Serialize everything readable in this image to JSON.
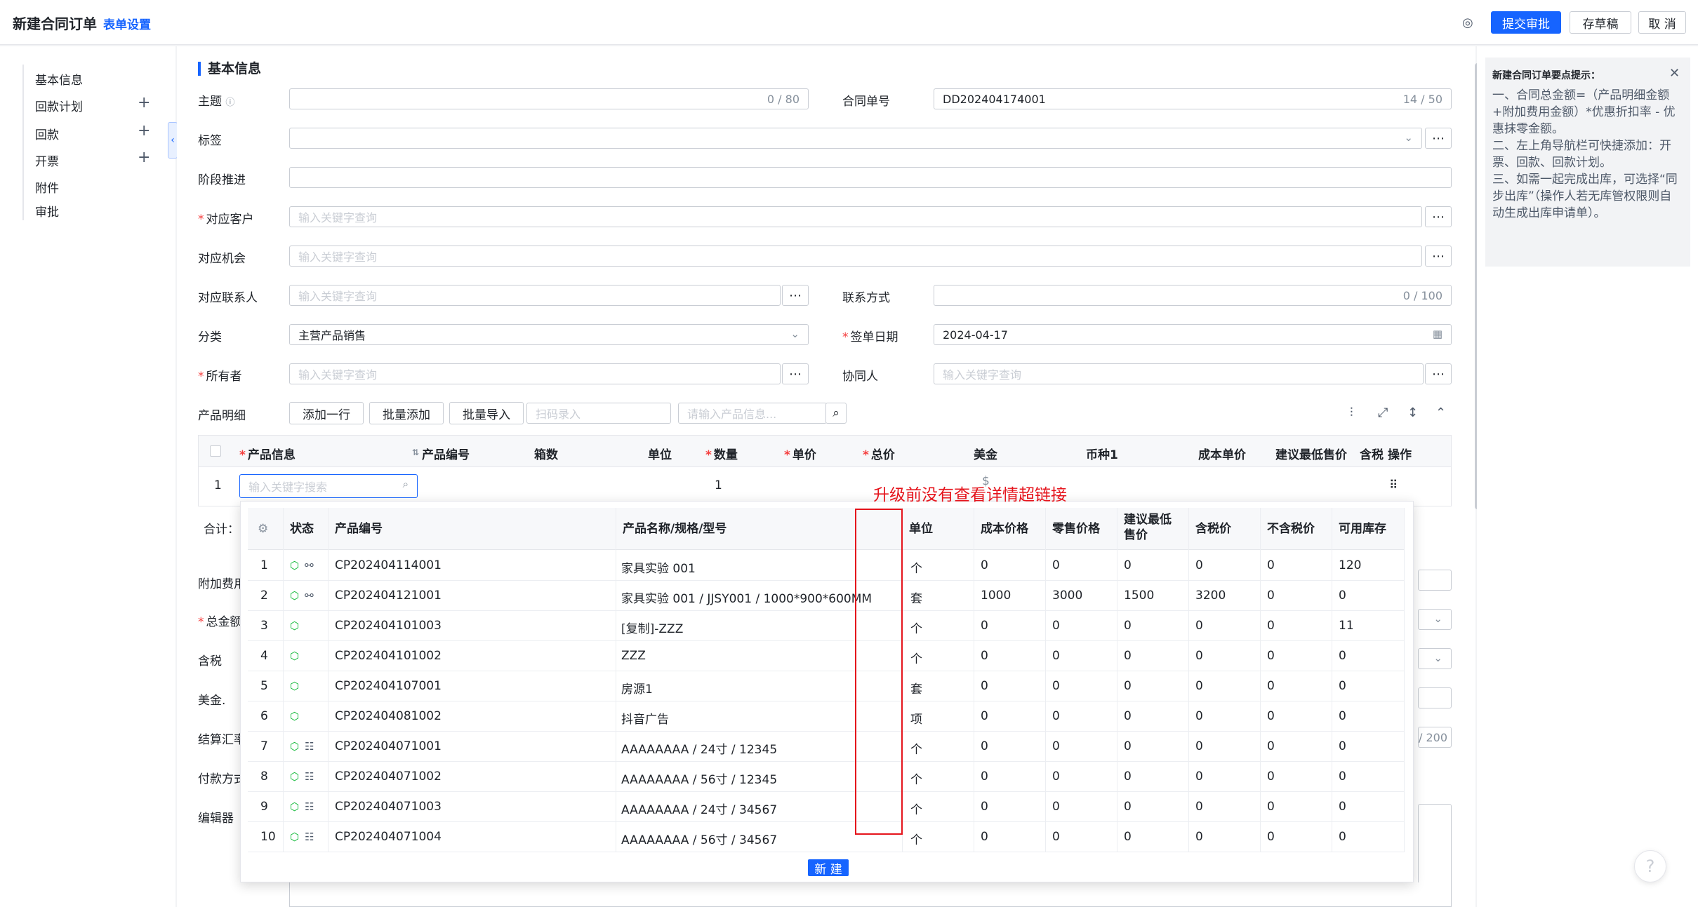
{
  "header": {
    "title": "新建合同订单",
    "form_setting": "表单设置",
    "submit": "提交审批",
    "draft": "存草稿",
    "cancel": "取 消"
  },
  "nav": {
    "items": [
      {
        "label": "基本信息",
        "plus": false
      },
      {
        "label": "回款计划",
        "plus": true
      },
      {
        "label": "回款",
        "plus": true
      },
      {
        "label": "开票",
        "plus": true
      },
      {
        "label": "附件",
        "plus": false
      },
      {
        "label": "审批",
        "plus": false
      }
    ]
  },
  "form": {
    "section_title": "基本信息",
    "subject": {
      "label": "主题",
      "counter": "0 / 80"
    },
    "contract_no": {
      "label": "合同单号",
      "value": "DD202404174001",
      "counter": "14 / 50"
    },
    "tag": {
      "label": "标签"
    },
    "stage": {
      "label": "阶段推进"
    },
    "customer": {
      "label": "对应客户",
      "placeholder": "输入关键字查询"
    },
    "opportunity": {
      "label": "对应机会",
      "placeholder": "输入关键字查询"
    },
    "contact": {
      "label": "对应联系人",
      "placeholder": "输入关键字查询"
    },
    "contact_method": {
      "label": "联系方式",
      "counter": "0 / 100"
    },
    "category": {
      "label": "分类",
      "value": "主营产品销售"
    },
    "sign_date": {
      "label": "签单日期",
      "value": "2024-04-17"
    },
    "owner": {
      "label": "所有者",
      "placeholder": "输入关键字查询"
    },
    "collaborator": {
      "label": "协同人",
      "placeholder": "输入关键字查询"
    },
    "product_detail_label": "产品明细",
    "add_row": "添加一行",
    "batch_add": "批量添加",
    "batch_import": "批量导入",
    "scan_placeholder": "扫码录入",
    "product_search_placeholder": "请输入产品信息...",
    "left_labels": [
      "合计：",
      "附加费用",
      "总金额",
      "含税",
      "美金.",
      "结算汇率",
      "付款方式",
      "编辑器"
    ],
    "right_counter_fragment": "/ 200"
  },
  "product_table": {
    "columns": [
      "产品信息",
      "产品编号",
      "箱数",
      "单位",
      "数量",
      "单价",
      "总价",
      "美金",
      "币种1",
      "成本单价",
      "建议最低售价",
      "含税",
      "操作"
    ],
    "row_index": "1",
    "search_placeholder": "输入关键字搜索",
    "qty": "1",
    "dollar": "$"
  },
  "dropdown": {
    "columns": [
      "状态",
      "产品编号",
      "产品名称/规格/型号",
      "单位",
      "成本价格",
      "零售价格",
      "建议最低售价",
      "含税价",
      "不含税价",
      "可用库存"
    ],
    "rows": [
      {
        "idx": "1",
        "code": "CP202404114001",
        "name": "家具实验 001",
        "unit": "个",
        "cost": "0",
        "retail": "0",
        "min": "0",
        "tax": "0",
        "notax": "0",
        "stock": "120",
        "icon": "link"
      },
      {
        "idx": "2",
        "code": "CP202404121001",
        "name": "家具实验 001 / JJSY001 / 1000*900*600MM",
        "unit": "套",
        "cost": "1000",
        "retail": "3000",
        "min": "1500",
        "tax": "3200",
        "notax": "0",
        "stock": "0",
        "icon": "link"
      },
      {
        "idx": "3",
        "code": "CP202404101003",
        "name": "[复制]-ZZZ",
        "unit": "个",
        "cost": "0",
        "retail": "0",
        "min": "0",
        "tax": "0",
        "notax": "0",
        "stock": "11",
        "icon": ""
      },
      {
        "idx": "4",
        "code": "CP202404101002",
        "name": "ZZZ",
        "unit": "个",
        "cost": "0",
        "retail": "0",
        "min": "0",
        "tax": "0",
        "notax": "0",
        "stock": "0",
        "icon": ""
      },
      {
        "idx": "5",
        "code": "CP202404107001",
        "name": "房源1",
        "unit": "套",
        "cost": "0",
        "retail": "0",
        "min": "0",
        "tax": "0",
        "notax": "0",
        "stock": "0",
        "icon": ""
      },
      {
        "idx": "6",
        "code": "CP202404081002",
        "name": "抖音广告",
        "unit": "项",
        "cost": "0",
        "retail": "0",
        "min": "0",
        "tax": "0",
        "notax": "0",
        "stock": "0",
        "icon": ""
      },
      {
        "idx": "7",
        "code": "CP202404071001",
        "name": "AAAAAAAA / 24寸 / 12345",
        "unit": "个",
        "cost": "0",
        "retail": "0",
        "min": "0",
        "tax": "0",
        "notax": "0",
        "stock": "0",
        "icon": "spec"
      },
      {
        "idx": "8",
        "code": "CP202404071002",
        "name": "AAAAAAAA / 56寸 / 12345",
        "unit": "个",
        "cost": "0",
        "retail": "0",
        "min": "0",
        "tax": "0",
        "notax": "0",
        "stock": "0",
        "icon": "spec"
      },
      {
        "idx": "9",
        "code": "CP202404071003",
        "name": "AAAAAAAA / 24寸 / 34567",
        "unit": "个",
        "cost": "0",
        "retail": "0",
        "min": "0",
        "tax": "0",
        "notax": "0",
        "stock": "0",
        "icon": "spec"
      },
      {
        "idx": "10",
        "code": "CP202404071004",
        "name": "AAAAAAAA / 56寸 / 34567",
        "unit": "个",
        "cost": "0",
        "retail": "0",
        "min": "0",
        "tax": "0",
        "notax": "0",
        "stock": "0",
        "icon": "spec"
      }
    ],
    "new_button": "新 建"
  },
  "annotation": "升级前没有查看详情超链接",
  "tips": {
    "title": "新建合同订单要点提示：",
    "lines": [
      "一、合同总金额=（产品明细金额+附加费用金额）*优惠折扣率 - 优惠抹零金额。",
      "二、左上角导航栏可快捷添加：开票、回款、回款计划。",
      "三、如需一起完成出库，可选择“同步出库”（操作人若无库管权限则自动生成出库申请单）。"
    ]
  },
  "colors": {
    "accent": "#1664ff",
    "required": "#f53f3f",
    "annotation": "#e5141c",
    "status_icon": "#00b42a"
  }
}
